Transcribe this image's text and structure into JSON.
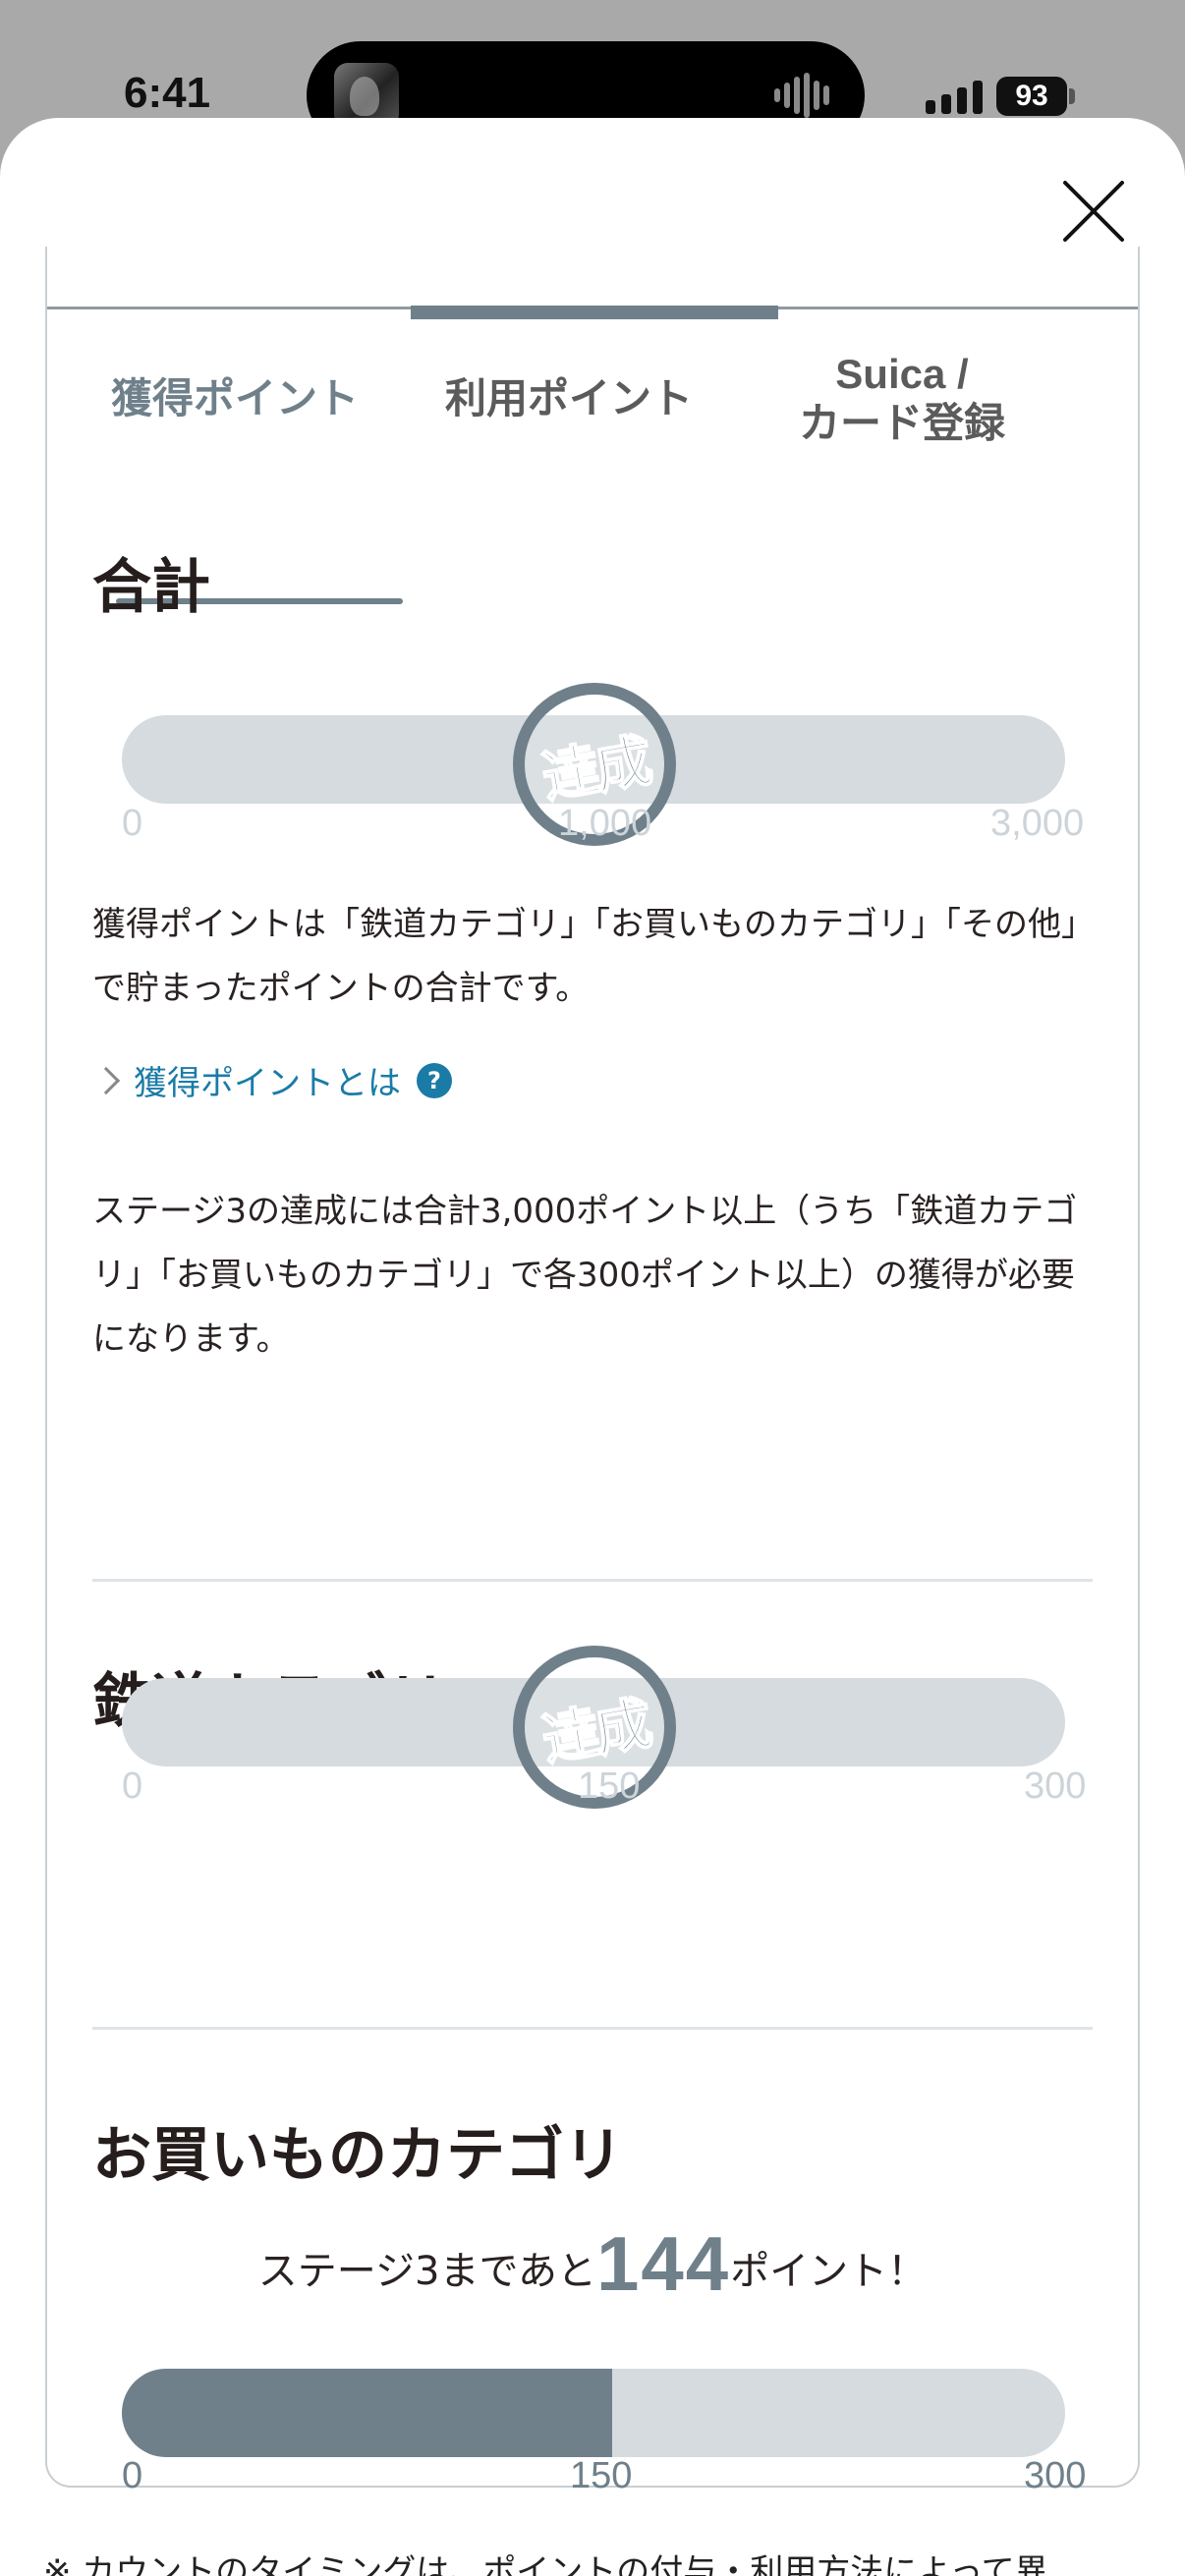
{
  "status_bar": {
    "time": "6:41",
    "battery": "93"
  },
  "tabs": [
    {
      "label": "獲得ポイント",
      "active": true
    },
    {
      "label": "利用ポイント",
      "active": false
    },
    {
      "label_line1": "Suica /",
      "label_line2": "カード登録",
      "active": false
    }
  ],
  "total": {
    "title": "合計",
    "stamp": "達成",
    "achieved": true,
    "ticks": [
      "0",
      "1,000",
      "3,000"
    ],
    "description": "獲得ポイントは「鉄道カテゴリ」「お買いものカテゴリ」「その他」で貯まったポイントの合計です。",
    "link_label": "獲得ポイントとは",
    "help_icon": "question-mark-circle-icon",
    "note": "ステージ3の達成には合計3,000ポイント以上（うち「鉄道カテゴリ」「お買いものカテゴリ」で各300ポイント以上）の獲得が必要になります。"
  },
  "rail": {
    "title": "鉄道カテゴリ",
    "stamp": "達成",
    "achieved": true,
    "ticks": [
      "0",
      "150",
      "300"
    ]
  },
  "shopping": {
    "title": "お買いものカテゴリ",
    "remain_prefix": "ステージ3まであと",
    "remain_value": "144",
    "remain_suffix": "ポイント！",
    "progress_fraction": 0.52,
    "ticks": [
      "0",
      "150",
      "300"
    ]
  },
  "footnote": "※ カウントのタイミングは、ポイントの付与・利用方法によって異",
  "colors": {
    "accent": "#6f808b",
    "track": "#d5dbdf",
    "link": "#1a7ba7"
  }
}
